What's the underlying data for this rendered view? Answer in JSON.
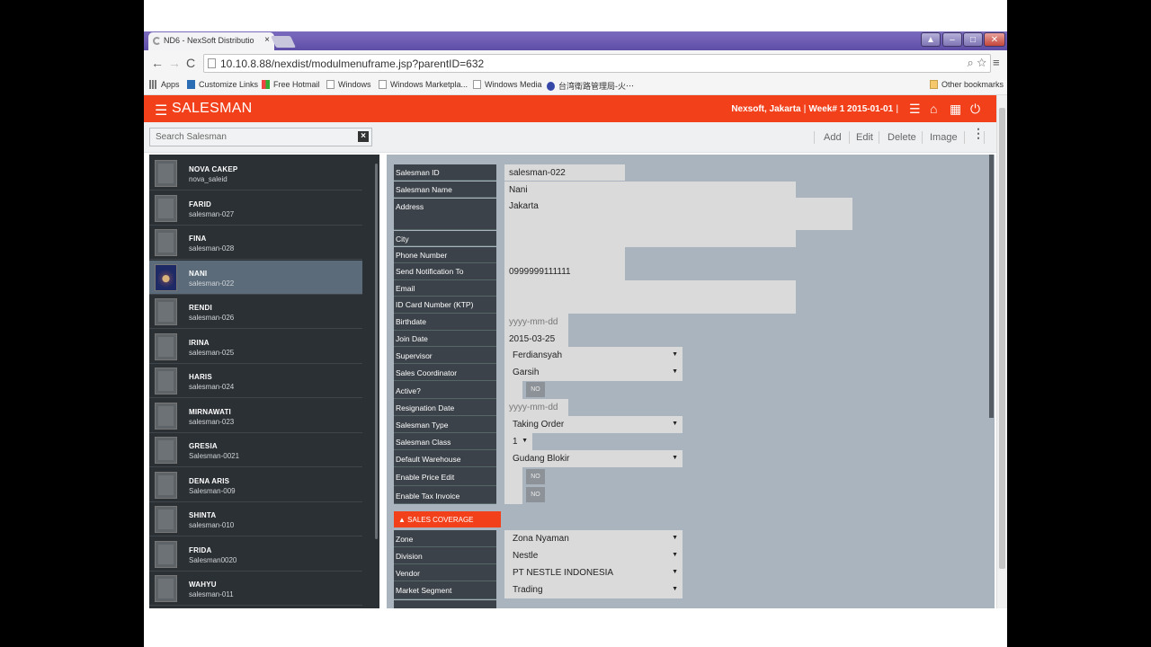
{
  "browser": {
    "tab_title": "ND6 - NexSoft Distributio",
    "tab_close": "×",
    "url": "10.10.8.88/nexdist/modulmenuframe.jsp?parentID=632",
    "bookmarks": [
      {
        "label": "Apps",
        "icon": "apps-grid-icon"
      },
      {
        "label": "Customize Links",
        "icon": "m-icon"
      },
      {
        "label": "Free Hotmail",
        "icon": "windows-flag-icon"
      },
      {
        "label": "Windows",
        "icon": "page-icon"
      },
      {
        "label": "Windows Marketpla...",
        "icon": "page-icon"
      },
      {
        "label": "Windows Media",
        "icon": "page-icon"
      },
      {
        "label": "台湾衛路管理局-火⋯",
        "icon": "globe-icon"
      }
    ],
    "other_bookmarks": "Other bookmarks"
  },
  "app": {
    "title": "SALESMAN",
    "company": "Nexsoft, Jakarta",
    "week": "Week# 1 2015-01-01",
    "accent_color": "#f2401a"
  },
  "toolbar": {
    "search_placeholder": "Search Salesman",
    "add": "Add",
    "edit": "Edit",
    "delete": "Delete",
    "image": "Image"
  },
  "salesmen": [
    {
      "name": "NOVA CAKEP",
      "id": "nova_saleid"
    },
    {
      "name": "FARID",
      "id": "salesman-027"
    },
    {
      "name": "FINA",
      "id": "salesman-028"
    },
    {
      "name": "NANI",
      "id": "salesman-022",
      "selected": true
    },
    {
      "name": "RENDI",
      "id": "salesman-026"
    },
    {
      "name": "IRINA",
      "id": "salesman-025"
    },
    {
      "name": "HARIS",
      "id": "salesman-024"
    },
    {
      "name": "MIRNAWATI",
      "id": "salesman-023"
    },
    {
      "name": "GRESIA",
      "id": "Salesman-0021"
    },
    {
      "name": "DENA ARIS",
      "id": "Salesman-009"
    },
    {
      "name": "SHINTA",
      "id": "salesman-010"
    },
    {
      "name": "FRIDA",
      "id": "Salesman0020"
    },
    {
      "name": "WAHYU",
      "id": "salesman-011"
    }
  ],
  "form": {
    "labels": {
      "salesman_id": "Salesman ID",
      "salesman_name": "Salesman Name",
      "address": "Address",
      "city": "City",
      "phone": "Phone Number",
      "send_notif": "Send Notification To",
      "email": "Email",
      "ktp": "ID Card Number (KTP)",
      "birthdate": "Birthdate",
      "join_date": "Join Date",
      "supervisor": "Supervisor",
      "coordinator": "Sales Coordinator",
      "active": "Active?",
      "resign": "Resignation Date",
      "type": "Salesman Type",
      "class": "Salesman Class",
      "warehouse": "Default Warehouse",
      "price_edit": "Enable Price Edit",
      "tax_invoice": "Enable Tax Invoice",
      "zone": "Zone",
      "division": "Division",
      "vendor": "Vendor",
      "market": "Market Segment"
    },
    "values": {
      "salesman_id": "salesman-022",
      "salesman_name": "Nani",
      "address": "Jakarta",
      "city": "",
      "phone": "",
      "send_notif": "0999999111111",
      "email": "",
      "ktp": "",
      "birthdate_placeholder": "yyyy-mm-dd",
      "join_date": "2015-03-25",
      "supervisor": "Ferdiansyah",
      "coordinator": "Garsih",
      "active": "NO",
      "resign_placeholder": "yyyy-mm-dd",
      "type": "Taking Order",
      "class": "1",
      "warehouse": "Gudang Blokir",
      "price_edit": "NO",
      "tax_invoice": "NO",
      "zone": "Zona Nyaman",
      "division": "Nestle",
      "vendor": "PT NESTLE INDONESIA",
      "market": "Trading"
    },
    "section_coverage": "SALES COVERAGE"
  }
}
